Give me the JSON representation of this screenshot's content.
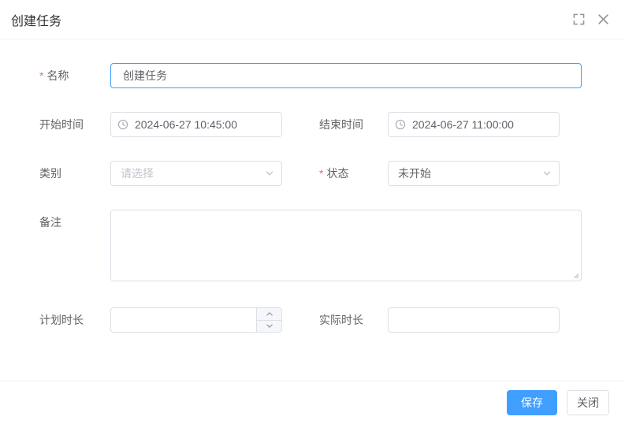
{
  "dialog": {
    "title": "创建任务"
  },
  "form": {
    "name": {
      "required_mark": "*",
      "label": "名称",
      "value": "创建任务"
    },
    "start_time": {
      "label": "开始时间",
      "value": "2024-06-27 10:45:00"
    },
    "end_time": {
      "label": "结束时间",
      "value": "2024-06-27 11:00:00"
    },
    "category": {
      "label": "类别",
      "placeholder": "请选择"
    },
    "status": {
      "required_mark": "*",
      "label": "状态",
      "value": "未开始"
    },
    "remark": {
      "label": "备注",
      "value": ""
    },
    "planned_duration": {
      "label": "计划时长",
      "value": ""
    },
    "actual_duration": {
      "label": "实际时长",
      "value": ""
    }
  },
  "footer": {
    "save_label": "保存",
    "close_label": "关闭"
  },
  "colors": {
    "accent": "#409eff",
    "required": "#f56c6c",
    "border": "#dcdfe6",
    "focus_border": "#409eff",
    "text": "#606266",
    "title_text": "#303133",
    "placeholder": "#c0c4cc",
    "icon_gray": "#909399"
  },
  "icons": {
    "fullscreen-icon": "corner-brackets",
    "close-icon": "x",
    "clock-icon": "circle-clock",
    "chevron-down-icon": "v",
    "arrow-up-icon": "^",
    "arrow-down-icon": "v",
    "resize-handle-icon": "diagonal-grip"
  }
}
